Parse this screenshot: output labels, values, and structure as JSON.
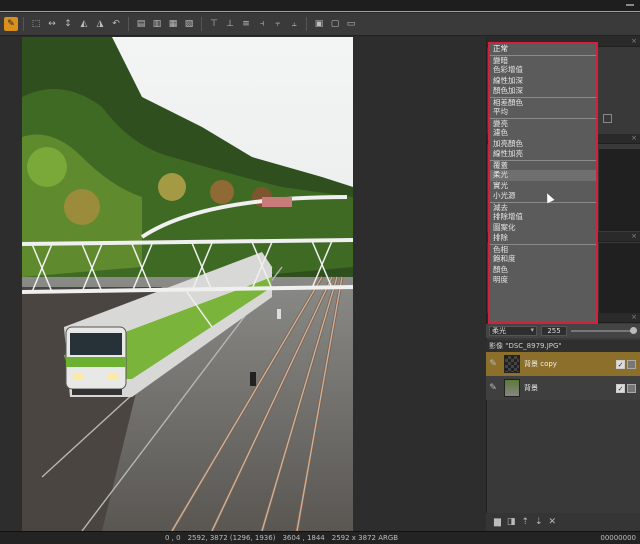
{
  "toolbar": {
    "tools": [
      "select",
      "crop",
      "flip-h",
      "flip-v",
      "rotate-left",
      "rotate-right",
      "undo",
      "align-1",
      "align-2",
      "align-3",
      "align-4",
      "dist-1",
      "dist-2",
      "dist-3",
      "dist-4",
      "dist-5",
      "dist-6",
      "grid-1",
      "grid-2",
      "grid-3"
    ]
  },
  "blend_menu": {
    "items": [
      "正常",
      "變暗",
      "色彩增值",
      "線性加深",
      "顏色加深",
      "相差顏色",
      "平均",
      "變亮",
      "濾色",
      "加亮顏色",
      "線性加亮",
      "覆蓋",
      "柔光",
      "實光",
      "小光源",
      "減去",
      "排除增值",
      "圖案化",
      "排除",
      "色相",
      "飽和度",
      "顏色",
      "明度"
    ],
    "selected_index": 12
  },
  "blend_bar": {
    "mode": "柔光",
    "opacity": "255"
  },
  "layers": {
    "header": "影像 \"DSC_8979.JPG\"",
    "items": [
      {
        "name": "背景 copy",
        "active": true
      },
      {
        "name": "背景",
        "active": false
      }
    ]
  },
  "layer_footer": {
    "icons": [
      "new-layer-icon",
      "duplicate-layer-icon",
      "move-up-icon",
      "move-down-icon",
      "delete-icon"
    ]
  },
  "status": {
    "coord": "0 , 0",
    "pos": "2592, 3872 (1296, 1936)",
    "selection": "3604 , 1844",
    "size": "2592 x 3872 ARGB",
    "color": "00000000"
  },
  "colors": {
    "accent": "#d9901e",
    "menu_border": "#d4203a",
    "active_layer": "#8b6f2a"
  }
}
